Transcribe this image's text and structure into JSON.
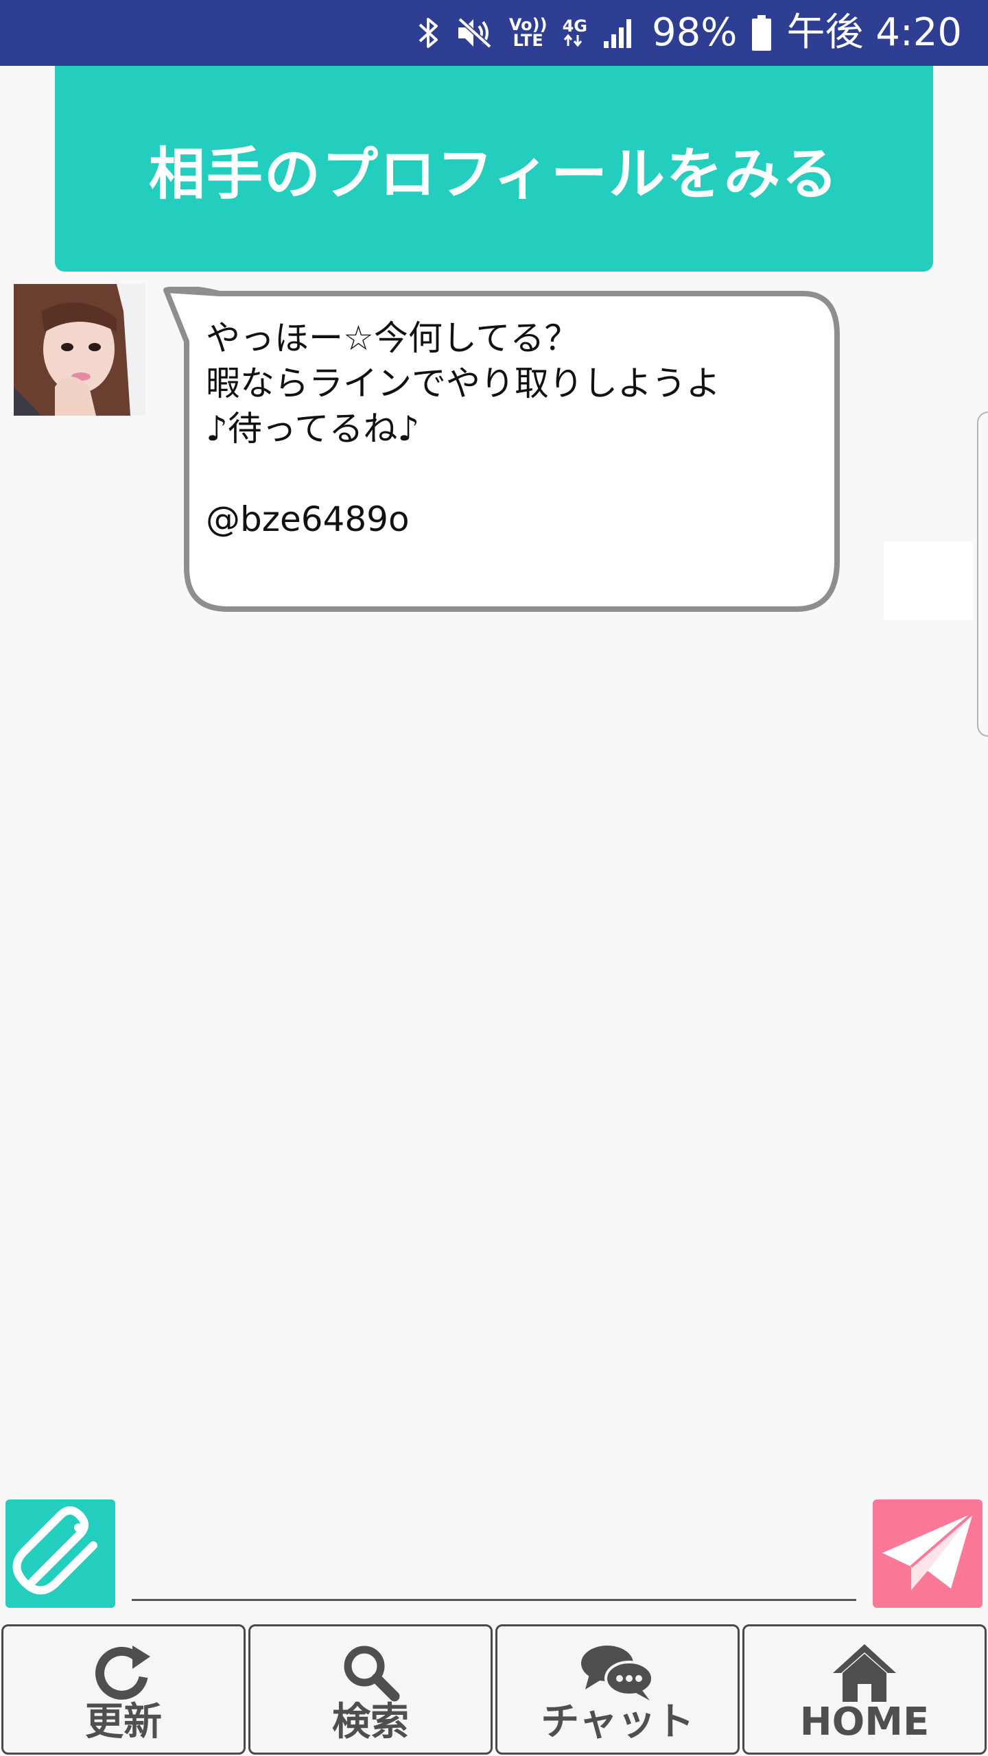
{
  "status_bar": {
    "battery_percent": "98%",
    "time": "午後 4:20",
    "volte_line1": "Vo))",
    "volte_line2": "LTE",
    "network": "4G",
    "icons": [
      "bluetooth-icon",
      "mute-icon",
      "volte-icon",
      "data-arrows-icon",
      "signal-icon",
      "battery-icon"
    ]
  },
  "profile_button": {
    "label": "相手のプロフィールをみる",
    "color": "#23cebe"
  },
  "message": {
    "text": "やっほー☆今何してる？\n暇ならラインでやり取りしようよ\n♪待ってるね♪\n\n@bze6489o"
  },
  "composer": {
    "input_value": "",
    "attach_icon": "paperclip-icon",
    "send_icon": "paper-plane-icon",
    "attach_color": "#23cebe",
    "send_color": "#fb7896"
  },
  "nav": {
    "items": [
      {
        "label": "更新",
        "icon": "refresh-icon"
      },
      {
        "label": "検索",
        "icon": "search-icon"
      },
      {
        "label": "チャット",
        "icon": "chat-bubbles-icon"
      },
      {
        "label": "HOME",
        "icon": "home-icon"
      }
    ]
  },
  "colors": {
    "status_bar": "#2d3e93",
    "background": "#f8f8f8"
  }
}
